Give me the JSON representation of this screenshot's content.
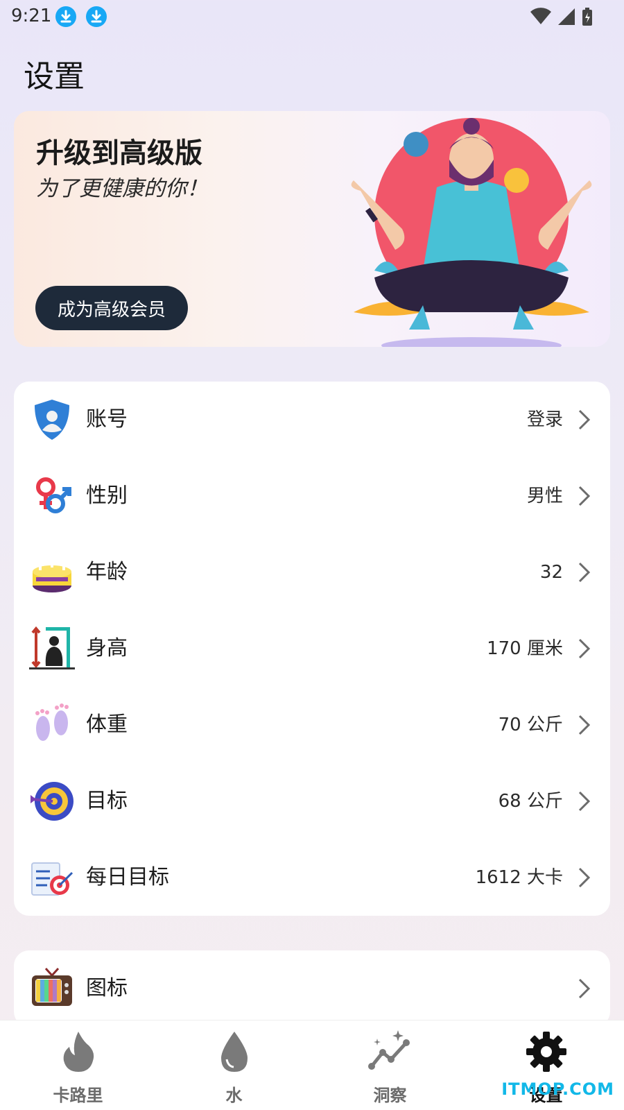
{
  "status_bar": {
    "time": "9:21"
  },
  "page": {
    "title": "设置"
  },
  "premium": {
    "title": "升级到高级版",
    "subtitle": "为了更健康的你！",
    "button_label": "成为高级会员"
  },
  "settings": {
    "rows": [
      {
        "label": "账号",
        "value": "登录",
        "icon": "shield-user-icon"
      },
      {
        "label": "性别",
        "value": "男性",
        "icon": "gender-icon"
      },
      {
        "label": "年龄",
        "value": "32",
        "icon": "cake-icon"
      },
      {
        "label": "身高",
        "value": "170 厘米",
        "icon": "height-icon"
      },
      {
        "label": "体重",
        "value": "70 公斤",
        "icon": "footprints-icon"
      },
      {
        "label": "目标",
        "value": "68 公斤",
        "icon": "target-icon"
      },
      {
        "label": "每日目标",
        "value": "1612 大卡",
        "icon": "checklist-target-icon"
      }
    ],
    "icons_row": {
      "label": "图标",
      "icon": "tv-icon"
    }
  },
  "nav": {
    "items": [
      {
        "label": "卡路里",
        "icon": "flame-icon",
        "active": false
      },
      {
        "label": "水",
        "icon": "water-drop-icon",
        "active": false
      },
      {
        "label": "洞察",
        "icon": "insights-icon",
        "active": false
      },
      {
        "label": "设置",
        "icon": "gear-icon",
        "active": true
      }
    ]
  },
  "watermark": "ITMOP.COM",
  "colors": {
    "accent_dark": "#1e2a3a",
    "download_blue": "#18a8f5",
    "watermark": "#12b8e8"
  }
}
